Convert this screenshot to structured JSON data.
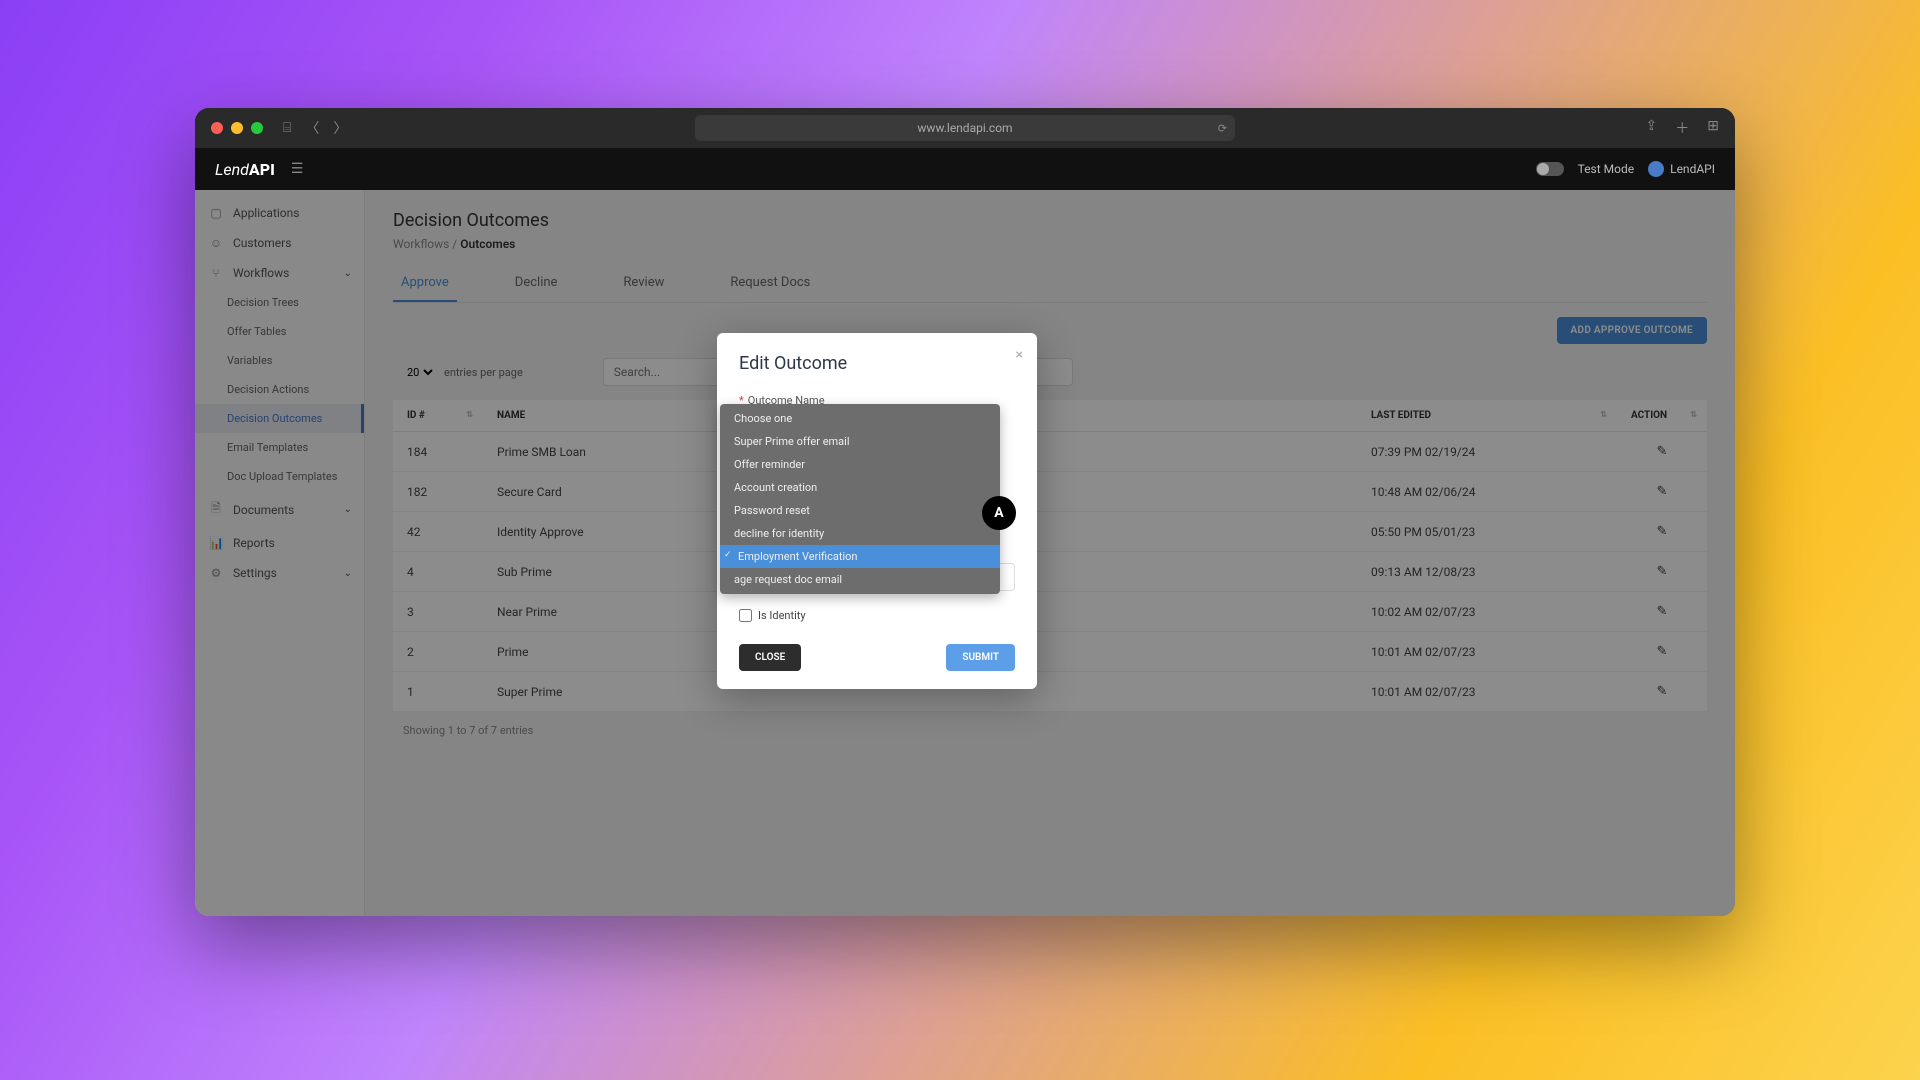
{
  "browser": {
    "url": "www.lendapi.com"
  },
  "header": {
    "brand_prefix": "Lend",
    "brand_bold": "API",
    "test_mode_label": "Test Mode",
    "user_name": "LendAPI"
  },
  "sidebar": {
    "items": [
      {
        "label": "Applications",
        "icon": "▢"
      },
      {
        "label": "Customers",
        "icon": "☺"
      },
      {
        "label": "Workflows",
        "icon": "⑂",
        "expanded": true
      },
      {
        "label": "Decision Trees",
        "sub": true
      },
      {
        "label": "Offer Tables",
        "sub": true
      },
      {
        "label": "Variables",
        "sub": true
      },
      {
        "label": "Decision Actions",
        "sub": true
      },
      {
        "label": "Decision Outcomes",
        "sub": true,
        "active": true
      },
      {
        "label": "Email Templates",
        "sub": true
      },
      {
        "label": "Doc Upload Templates",
        "sub": true
      },
      {
        "label": "Documents",
        "icon": "🗎",
        "expanded": false
      },
      {
        "label": "Reports",
        "icon": "📊"
      },
      {
        "label": "Settings",
        "icon": "⚙",
        "expanded": false
      }
    ]
  },
  "page": {
    "title": "Decision Outcomes",
    "breadcrumb_parent": "Workflows",
    "breadcrumb_sep": " / ",
    "breadcrumb_current": "Outcomes"
  },
  "tabs": [
    {
      "label": "Approve",
      "active": true
    },
    {
      "label": "Decline"
    },
    {
      "label": "Review"
    },
    {
      "label": "Request Docs"
    }
  ],
  "toolbar": {
    "add_btn": "ADD APPROVE OUTCOME",
    "page_size": "20",
    "page_size_suffix": "entries per page",
    "search_placeholder": "Search..."
  },
  "table": {
    "columns": [
      "ID #",
      "NAME",
      "",
      "LAST EDITED",
      "ACTION"
    ],
    "rows": [
      {
        "id": "184",
        "name": "Prime SMB Loan",
        "edited": "07:39 PM 02/19/24"
      },
      {
        "id": "182",
        "name": "Secure Card",
        "edited": "10:48 AM 02/06/24"
      },
      {
        "id": "42",
        "name": "Identity Approve",
        "edited": "05:50 PM 05/01/23"
      },
      {
        "id": "4",
        "name": "Sub Prime",
        "edited": "09:13 AM 12/08/23"
      },
      {
        "id": "3",
        "name": "Near Prime",
        "edited": "10:02 AM 02/07/23"
      },
      {
        "id": "2",
        "name": "Prime",
        "edited": "10:01 AM 02/07/23"
      },
      {
        "id": "1",
        "name": "Super Prime",
        "edited": "10:01 AM 02/07/23"
      }
    ],
    "footer": "Showing 1 to 7 of 7 entries"
  },
  "modal": {
    "title": "Edit Outcome",
    "outcome_name_label": "Outcome Name",
    "is_identity_label": "Is Identity",
    "close_btn": "CLOSE",
    "submit_btn": "SUBMIT"
  },
  "dropdown": {
    "options": [
      "Choose one",
      "Super Prime offer email",
      "Offer reminder",
      "Account creation",
      "Password reset",
      "decline for identity",
      "Employment Verification",
      "age request doc email"
    ],
    "selected_index": 6
  },
  "annotation": {
    "label": "A"
  }
}
